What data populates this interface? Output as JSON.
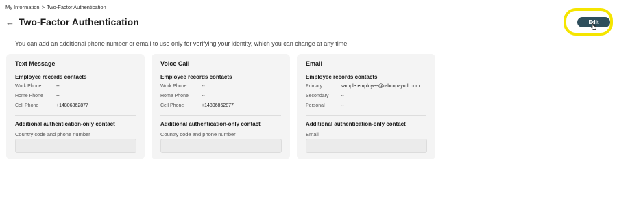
{
  "breadcrumb": {
    "parent": "My Information",
    "separator": ">",
    "current": "Two-Factor Authentication"
  },
  "header": {
    "back_icon": "arrow-left-icon",
    "title": "Two-Factor Authentication",
    "edit_label": "Edit"
  },
  "intro": "You can add an additional phone number or email to use only for verifying your identity, which you can change at any time.",
  "cards": [
    {
      "title": "Text Message",
      "section": "Employee records contacts",
      "rows": [
        {
          "label": "Work Phone",
          "value": "--"
        },
        {
          "label": "Home Phone",
          "value": "--"
        },
        {
          "label": "Cell Phone",
          "value": "+14806862877"
        }
      ],
      "additional": "Additional authentication-only contact",
      "field_label": "Country code and phone number",
      "field_value": ""
    },
    {
      "title": "Voice Call",
      "section": "Employee records contacts",
      "rows": [
        {
          "label": "Work Phone",
          "value": "--"
        },
        {
          "label": "Home Phone",
          "value": "--"
        },
        {
          "label": "Cell Phone",
          "value": "+14806862877"
        }
      ],
      "additional": "Additional authentication-only contact",
      "field_label": "Country code and phone number",
      "field_value": ""
    },
    {
      "title": "Email",
      "section": "Employee records contacts",
      "rows": [
        {
          "label": "Primary",
          "value": "sample.employee@rabcopayroll.com"
        },
        {
          "label": "Secondary",
          "value": "--"
        },
        {
          "label": "Personal",
          "value": "--"
        }
      ],
      "additional": "Additional authentication-only contact",
      "field_label": "Email",
      "field_value": ""
    }
  ],
  "colors": {
    "edit_button": "#2f4f5c",
    "highlight": "#f5e500",
    "card_bg": "#f4f4f4",
    "field_bg": "#ebebeb"
  }
}
